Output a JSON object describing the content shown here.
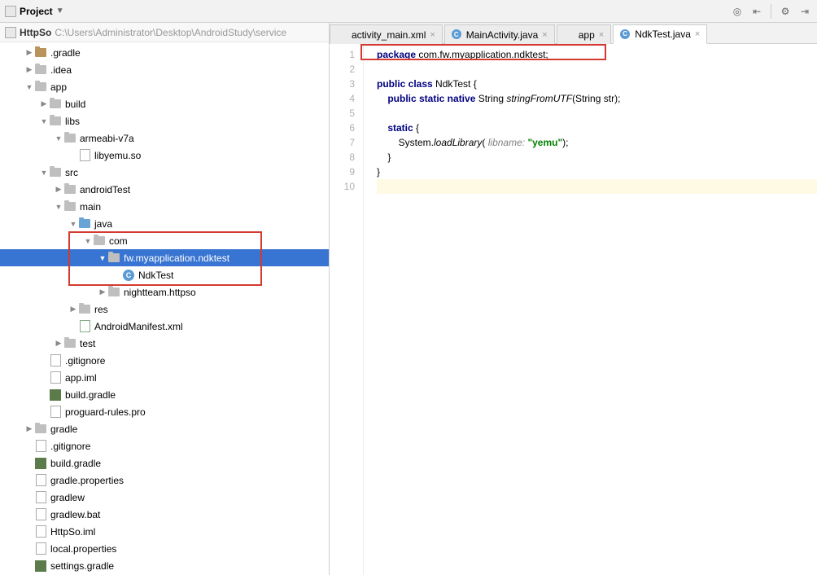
{
  "toolbar": {
    "project_label": "Project"
  },
  "breadcrumb": {
    "root": "HttpSo",
    "path": "C:\\Users\\Administrator\\Desktop\\AndroidStudy\\service"
  },
  "tree": [
    {
      "d": 0,
      "a": "r",
      "i": "folder",
      "t": ".gradle"
    },
    {
      "d": 0,
      "a": "r",
      "i": "folder-grey",
      "t": ".idea"
    },
    {
      "d": 0,
      "a": "d",
      "i": "folder-grey",
      "t": "app"
    },
    {
      "d": 1,
      "a": "r",
      "i": "folder-grey",
      "t": "build"
    },
    {
      "d": 1,
      "a": "d",
      "i": "folder-grey",
      "t": "libs"
    },
    {
      "d": 2,
      "a": "d",
      "i": "folder-grey",
      "t": "armeabi-v7a"
    },
    {
      "d": 3,
      "a": "n",
      "i": "file",
      "t": "libyemu.so"
    },
    {
      "d": 1,
      "a": "d",
      "i": "folder-grey",
      "t": "src"
    },
    {
      "d": 2,
      "a": "r",
      "i": "folder-grey",
      "t": "androidTest"
    },
    {
      "d": 2,
      "a": "d",
      "i": "folder-grey",
      "t": "main"
    },
    {
      "d": 3,
      "a": "d",
      "i": "folder-blue",
      "t": "java"
    },
    {
      "d": 4,
      "a": "d",
      "i": "folder-pkg",
      "t": "com",
      "hl": true
    },
    {
      "d": 5,
      "a": "d",
      "i": "folder-pkg",
      "t": "fw.myapplication.ndktest",
      "sel": true,
      "hl": true
    },
    {
      "d": 6,
      "a": "n",
      "i": "java",
      "t": "NdkTest",
      "hl": true
    },
    {
      "d": 5,
      "a": "r",
      "i": "folder-pkg",
      "t": "nightteam.httpso"
    },
    {
      "d": 3,
      "a": "r",
      "i": "folder-grey",
      "t": "res"
    },
    {
      "d": 3,
      "a": "n",
      "i": "xml",
      "t": "AndroidManifest.xml"
    },
    {
      "d": 2,
      "a": "r",
      "i": "folder-grey",
      "t": "test"
    },
    {
      "d": 1,
      "a": "n",
      "i": "file",
      "t": ".gitignore"
    },
    {
      "d": 1,
      "a": "n",
      "i": "file",
      "t": "app.iml"
    },
    {
      "d": 1,
      "a": "n",
      "i": "gradle",
      "t": "build.gradle"
    },
    {
      "d": 1,
      "a": "n",
      "i": "file",
      "t": "proguard-rules.pro"
    },
    {
      "d": 0,
      "a": "r",
      "i": "folder-grey",
      "t": "gradle"
    },
    {
      "d": 0,
      "a": "n",
      "i": "file",
      "t": ".gitignore"
    },
    {
      "d": 0,
      "a": "n",
      "i": "gradle",
      "t": "build.gradle"
    },
    {
      "d": 0,
      "a": "n",
      "i": "file",
      "t": "gradle.properties"
    },
    {
      "d": 0,
      "a": "n",
      "i": "file",
      "t": "gradlew"
    },
    {
      "d": 0,
      "a": "n",
      "i": "file",
      "t": "gradlew.bat"
    },
    {
      "d": 0,
      "a": "n",
      "i": "file",
      "t": "HttpSo.iml"
    },
    {
      "d": 0,
      "a": "n",
      "i": "file",
      "t": "local.properties"
    },
    {
      "d": 0,
      "a": "n",
      "i": "gradle",
      "t": "settings.gradle"
    }
  ],
  "tabs": [
    {
      "icon": "xml",
      "label": "activity_main.xml",
      "active": false
    },
    {
      "icon": "java",
      "label": "MainActivity.java",
      "active": false
    },
    {
      "icon": "app",
      "label": "app",
      "active": false
    },
    {
      "icon": "java",
      "label": "NdkTest.java",
      "active": true
    }
  ],
  "code": {
    "lines": [
      "1",
      "2",
      "3",
      "4",
      "5",
      "6",
      "7",
      "8",
      "9",
      "10"
    ],
    "l1_kw": "package",
    "l1_rest": " com.fw.myapplication.ndktest;",
    "l3_kw": "public class",
    "l3_cls": " NdkTest ",
    "l3_brace": "{",
    "l4_kw": "    public static native",
    "l4_rest": " String ",
    "l4_m": "stringFromUTF",
    "l4_tail": "(String str);",
    "l6_kw": "    static",
    "l6_brace": " {",
    "l7_pre": "        System.",
    "l7_m": "loadLibrary",
    "l7_open": "( ",
    "l7_cmt": "libname:",
    "l7_sp": " ",
    "l7_str": "\"yemu\"",
    "l7_close": ");",
    "l8": "    }",
    "l9": "}"
  }
}
